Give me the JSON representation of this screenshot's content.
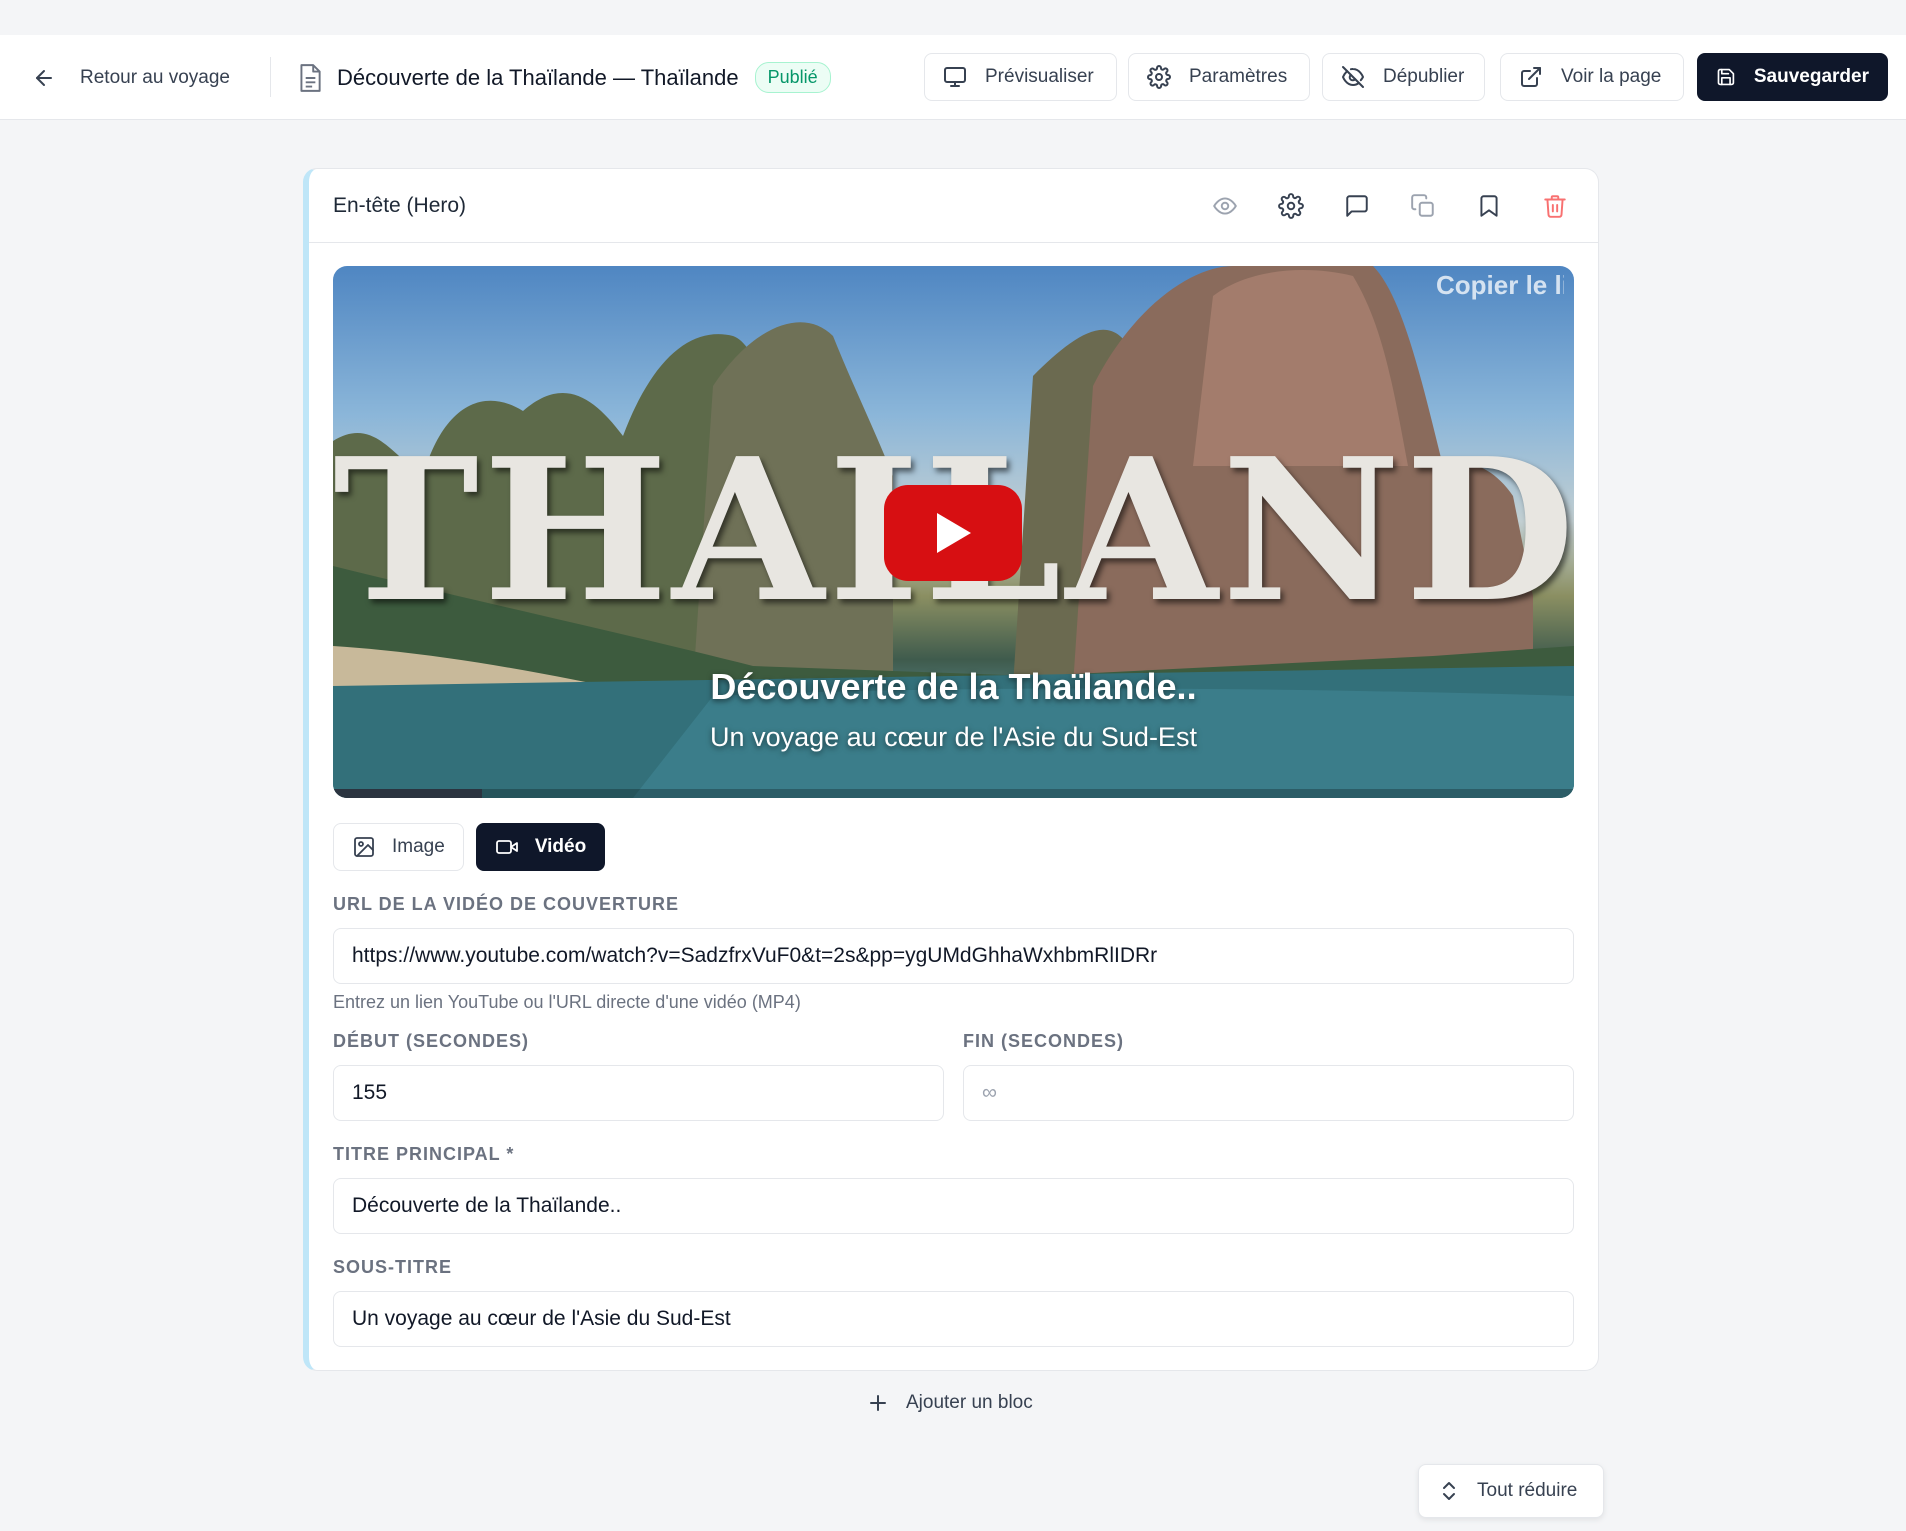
{
  "topbar": {
    "back_label": "Retour au voyage",
    "doc_title": "Découverte de la Thaïlande — Thaïlande",
    "status_badge": "Publié",
    "preview_label": "Prévisualiser",
    "settings_label": "Paramètres",
    "unpublish_label": "Dépublier",
    "view_page_label": "Voir la page",
    "save_label": "Sauvegarder"
  },
  "block": {
    "title": "En-tête (Hero)",
    "header_icons": [
      "eye-icon",
      "gear-icon",
      "comment-icon",
      "duplicate-icon",
      "bookmark-icon",
      "trash-icon"
    ],
    "hero": {
      "copy_link_overlay": "Copier le lien",
      "video_word": "THAILAND",
      "title": "Découverte de la Thaïlande..",
      "subtitle": "Un voyage au cœur de l'Asie du Sud-Est",
      "progress_fraction": 0.12
    },
    "media_type": {
      "image_label": "Image",
      "video_label": "Vidéo",
      "selected": "Vidéo"
    },
    "fields": {
      "video_url_label": "URL DE LA VIDÉO DE COUVERTURE",
      "video_url_value": "https://www.youtube.com/watch?v=SadzfrxVuF0&t=2s&pp=ygUMdGhhaWxhbmRlIDRr",
      "video_url_hint": "Entrez un lien YouTube ou l'URL directe d'une vidéo (MP4)",
      "start_label": "DÉBUT (SECONDES)",
      "start_value": "155",
      "end_label": "FIN (SECONDES)",
      "end_placeholder": "∞",
      "main_title_label": "TITRE PRINCIPAL *",
      "main_title_value": "Découverte de la Thaïlande..",
      "subtitle_label": "SOUS-TITRE",
      "subtitle_value": "Un voyage au cœur de l'Asie du Sud-Est"
    }
  },
  "add_block_label": "Ajouter un bloc",
  "collapse_all_label": "Tout réduire",
  "colors": {
    "primary_dark": "#0f172a",
    "published_green": "#059669",
    "accent_border": "#bfe6f8",
    "youtube_red": "#d70f12",
    "delete_red": "#f87171"
  }
}
